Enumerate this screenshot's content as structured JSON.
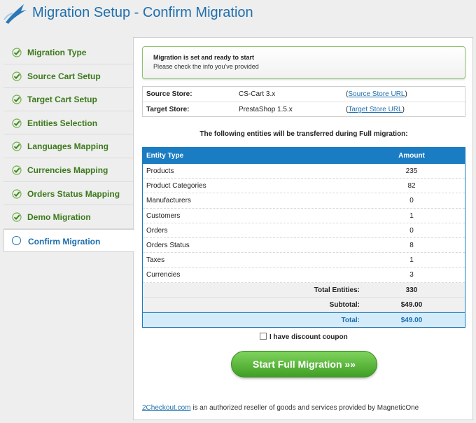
{
  "header": {
    "title": "Migration Setup - Confirm Migration"
  },
  "sidebar": {
    "items": [
      {
        "label": "Migration Type"
      },
      {
        "label": "Source Cart Setup"
      },
      {
        "label": "Target Cart Setup"
      },
      {
        "label": "Entities Selection"
      },
      {
        "label": "Languages Mapping"
      },
      {
        "label": "Currencies Mapping"
      },
      {
        "label": "Orders Status Mapping"
      },
      {
        "label": "Demo Migration"
      },
      {
        "label": "Confirm Migration"
      }
    ]
  },
  "notice": {
    "title": "Migration is set and ready to start",
    "text": "Please check the info you've provided"
  },
  "stores": {
    "source": {
      "label": "Source Store:",
      "value": "CS-Cart 3.x",
      "link_open": "(",
      "link": "Source Store URL",
      "link_close": ")"
    },
    "target": {
      "label": "Target Store:",
      "value": "PrestaShop 1.5.x",
      "link_open": "(",
      "link": "Target Store URL",
      "link_close": ")"
    }
  },
  "caption": "The following entities will be transferred during Full migration:",
  "table": {
    "headers": [
      "Entity Type",
      "Amount"
    ],
    "rows": [
      {
        "entity": "Products",
        "amount": "235"
      },
      {
        "entity": "Product Categories",
        "amount": "82"
      },
      {
        "entity": "Manufacturers",
        "amount": "0"
      },
      {
        "entity": "Customers",
        "amount": "1"
      },
      {
        "entity": "Orders",
        "amount": "0"
      },
      {
        "entity": "Orders Status",
        "amount": "8"
      },
      {
        "entity": "Taxes",
        "amount": "1"
      },
      {
        "entity": "Currencies",
        "amount": "3"
      }
    ],
    "total_entities": {
      "label": "Total Entities:",
      "value": "330"
    },
    "subtotal": {
      "label": "Subtotal:",
      "value": "$49.00"
    },
    "total": {
      "label": "Total:",
      "value": "$49.00"
    }
  },
  "coupon": {
    "label": "I have discount coupon"
  },
  "start_button": {
    "label": "Start Full Migration »»"
  },
  "footer": {
    "link": "2Checkout.com",
    "text": " is an authorized reseller of goods and services provided by MagneticOne"
  },
  "colors": {
    "brand_blue": "#1e6fae",
    "green": "#3c7a1b",
    "button_green": "#4caf2a"
  }
}
